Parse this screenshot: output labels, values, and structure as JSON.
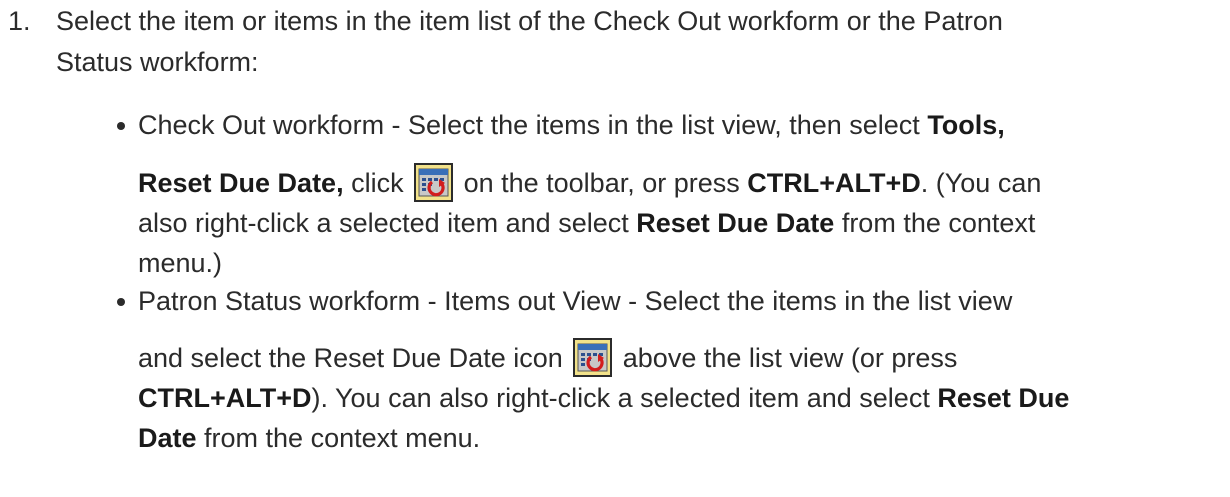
{
  "step1": {
    "number": "1.",
    "line1": "Select the item or items in the item list of the Check Out workform or the Patron",
    "line2": "Status workform:"
  },
  "bullet1": {
    "l1_text": "Check Out workform - Select the items in the list view, then select ",
    "l1_bold": "Tools,",
    "l2_bold1": "Reset Due Date,",
    "l2_text1": " click ",
    "l2_text2": " on the toolbar, or press ",
    "l2_bold2": "CTRL+ALT+D",
    "l2_text3": ". (You can",
    "l3_text1": "also right-click a selected item and select ",
    "l3_bold": "Reset Due Date",
    "l3_text2": " from the context",
    "l4_text": "menu.)"
  },
  "bullet2": {
    "l1_text": "Patron Status workform - Items out View - Select the items in the list view",
    "l2_text1": "and select the Reset Due Date icon ",
    "l2_text2": " above the list view (or press",
    "l3_bold1": "CTRL+ALT+D",
    "l3_text1": "). You can also right-click a selected item and select ",
    "l3_bold2": "Reset Due",
    "l4_bold": "Date",
    "l4_text": " from the context menu."
  },
  "icons": {
    "reset_due_date": "reset-due-date-calendar-icon"
  }
}
